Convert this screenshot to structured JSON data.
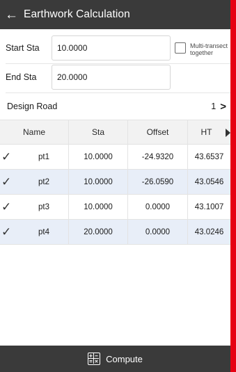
{
  "header": {
    "back_icon": "arrow-left-icon",
    "title": "Earthwork Calculation"
  },
  "form": {
    "start_sta_label": "Start Sta",
    "start_sta_value": "10.0000",
    "end_sta_label": "End Sta",
    "end_sta_value": "20.0000",
    "multi_transect_label": "Multi-transect together",
    "multi_transect_checked": false
  },
  "design_road": {
    "label": "Design Road",
    "value": "1"
  },
  "table": {
    "columns": [
      "Name",
      "Sta",
      "Offset",
      "HT"
    ],
    "rows": [
      {
        "checked": true,
        "name": "pt1",
        "sta": "10.0000",
        "offset": "-24.9320",
        "ht": "43.6537"
      },
      {
        "checked": true,
        "name": "pt2",
        "sta": "10.0000",
        "offset": "-26.0590",
        "ht": "43.0546"
      },
      {
        "checked": true,
        "name": "pt3",
        "sta": "10.0000",
        "offset": "0.0000",
        "ht": "43.1007"
      },
      {
        "checked": true,
        "name": "pt4",
        "sta": "20.0000",
        "offset": "0.0000",
        "ht": "43.0246"
      }
    ]
  },
  "bottom": {
    "icon": "calculator-icon",
    "compute_label": "Compute"
  },
  "colors": {
    "bar_bg": "#3a3a3a",
    "row_highlight": "#e8eef8",
    "edge_red": "#e60012"
  }
}
